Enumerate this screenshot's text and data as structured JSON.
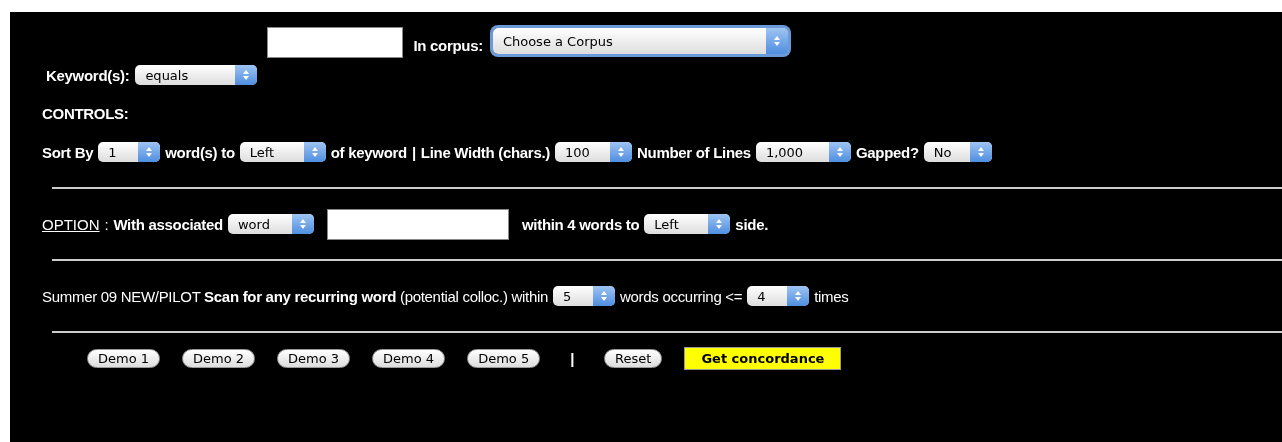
{
  "search": {
    "keyword_label": "Keyword(s):",
    "match": "equals",
    "corpus_label": "In corpus:",
    "corpus": "Choose a Corpus",
    "corpus_focused": true
  },
  "controls_heading": "CONTROLS:",
  "rows": [
    {
      "parts": [
        {
          "kind": "label",
          "text": "Sort By"
        },
        {
          "kind": "select",
          "value": "1"
        },
        {
          "kind": "label",
          "text": "word(s) to"
        },
        {
          "kind": "select",
          "value": "Left"
        },
        {
          "kind": "label",
          "text": "of keyword"
        },
        {
          "kind": "label",
          "text": "|"
        },
        {
          "kind": "label",
          "text": "Line Width (chars.)"
        },
        {
          "kind": "select",
          "value": "100"
        },
        {
          "kind": "label",
          "text": "Number of Lines"
        },
        {
          "kind": "select",
          "value": "1,000"
        },
        {
          "kind": "label",
          "text": "Gapped?"
        },
        {
          "kind": "select",
          "value": "No"
        }
      ]
    },
    {
      "parts": [
        {
          "kind": "link",
          "text": "OPTION"
        },
        {
          "kind": "plain",
          "text": ":"
        },
        {
          "kind": "label",
          "text": "With associated"
        },
        {
          "kind": "select",
          "value": "word"
        },
        {
          "kind": "input"
        },
        {
          "kind": "label",
          "text": "within 4 words to"
        },
        {
          "kind": "select",
          "value": "Left"
        },
        {
          "kind": "label",
          "text": "side."
        }
      ]
    },
    {
      "parts": [
        {
          "kind": "plain",
          "text": "Summer 09 NEW/PILOT **Scan for any recurring word** (potential colloc.) within"
        },
        {
          "kind": "select",
          "value": "5"
        },
        {
          "kind": "plain",
          "text": "words occurring <="
        },
        {
          "kind": "select",
          "value": "4"
        },
        {
          "kind": "plain",
          "text": "times"
        }
      ]
    }
  ],
  "buttons": [
    {
      "kind": "pill",
      "label": "Demo 1"
    },
    {
      "kind": "pill",
      "label": "Demo 2"
    },
    {
      "kind": "pill",
      "label": "Demo 3"
    },
    {
      "kind": "pill",
      "label": "Demo 4"
    },
    {
      "kind": "pill",
      "label": "Demo 5"
    },
    {
      "kind": "separator",
      "label": "|"
    },
    {
      "kind": "pill",
      "label": "Reset"
    },
    {
      "kind": "primary",
      "label": "Get concordance"
    }
  ]
}
